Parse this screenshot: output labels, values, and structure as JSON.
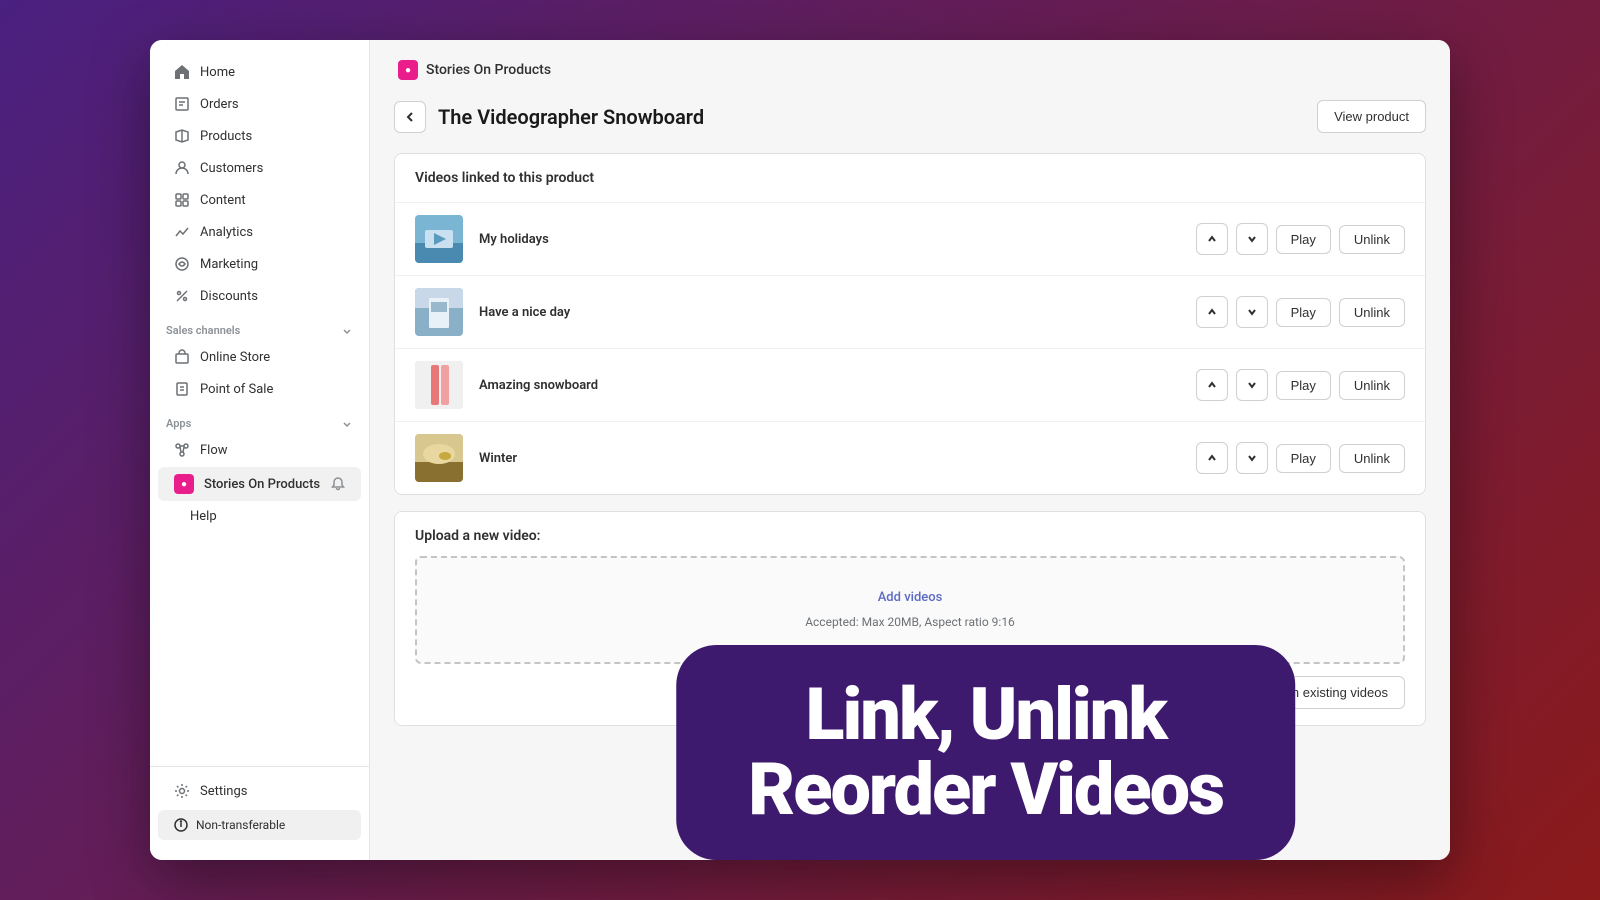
{
  "sidebar": {
    "nav_items": [
      {
        "id": "home",
        "label": "Home",
        "icon": "home"
      },
      {
        "id": "orders",
        "label": "Orders",
        "icon": "orders"
      },
      {
        "id": "products",
        "label": "Products",
        "icon": "products"
      },
      {
        "id": "customers",
        "label": "Customers",
        "icon": "customers"
      },
      {
        "id": "content",
        "label": "Content",
        "icon": "content"
      },
      {
        "id": "analytics",
        "label": "Analytics",
        "icon": "analytics"
      },
      {
        "id": "marketing",
        "label": "Marketing",
        "icon": "marketing"
      },
      {
        "id": "discounts",
        "label": "Discounts",
        "icon": "discounts"
      }
    ],
    "sales_channels_label": "Sales channels",
    "sales_channels": [
      {
        "id": "online-store",
        "label": "Online Store"
      },
      {
        "id": "point-of-sale",
        "label": "Point of Sale"
      }
    ],
    "apps_label": "Apps",
    "apps": [
      {
        "id": "flow",
        "label": "Flow"
      },
      {
        "id": "stories-on-products",
        "label": "Stories On Products"
      }
    ],
    "sub_items": [
      {
        "id": "help",
        "label": "Help"
      }
    ],
    "settings_label": "Settings",
    "non_transferable_label": "Non-transferable"
  },
  "header": {
    "app_name": "Stories On Products",
    "back_button_label": "←",
    "page_title": "The Videographer Snowboard",
    "view_product_label": "View product"
  },
  "videos_card": {
    "title": "Videos linked to this product",
    "videos": [
      {
        "id": "v1",
        "name": "My holidays",
        "thumbnail_color": "#7ab5d4"
      },
      {
        "id": "v2",
        "name": "Have a nice day",
        "thumbnail_color": "#a0b8c8"
      },
      {
        "id": "v3",
        "name": "Amazing snowboard",
        "thumbnail_color": "#e8a0a0"
      },
      {
        "id": "v4",
        "name": "Winter",
        "thumbnail_color": "#c8b87a"
      }
    ],
    "up_label": "↑",
    "down_label": "↓",
    "play_label": "Play",
    "unlink_label": "Unlink"
  },
  "upload_card": {
    "title": "Upload a new video:",
    "add_videos_label": "Add videos",
    "hint": "Accepted: Max 20MB, Aspect ratio 9:16",
    "choose_existing_label": "Or choose from existing videos"
  },
  "overlay": {
    "line1": "Link, Unlink",
    "line2": "Reorder Videos"
  }
}
